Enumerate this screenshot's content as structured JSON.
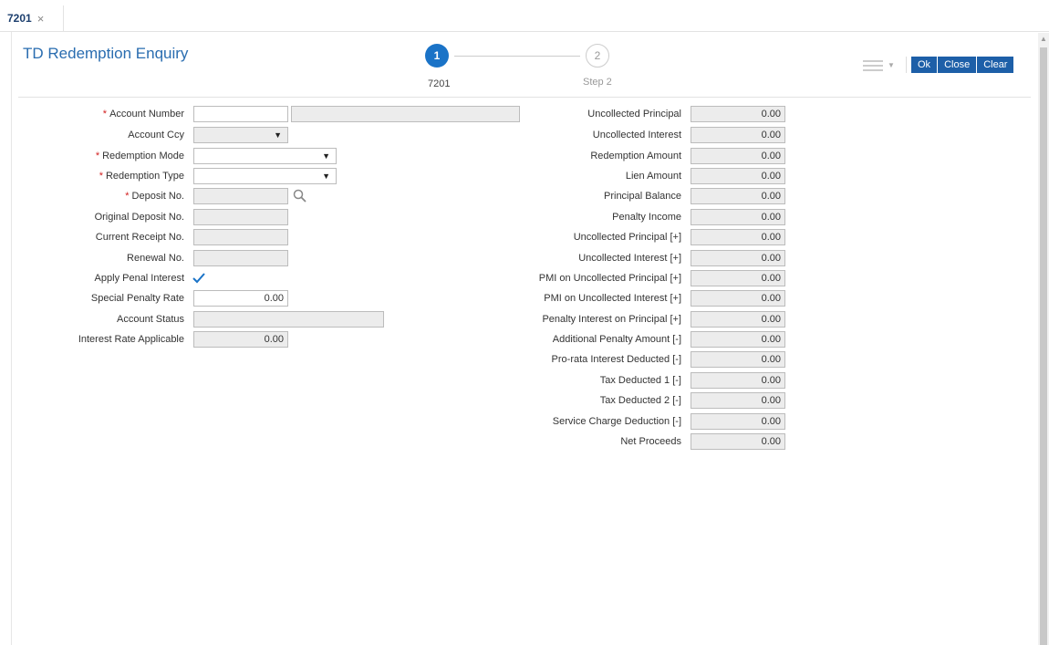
{
  "tab": {
    "label": "7201",
    "close": "×"
  },
  "title": "TD Redemption Enquiry",
  "steps": [
    {
      "number": "1",
      "label": "7201"
    },
    {
      "number": "2",
      "label": "Step 2"
    }
  ],
  "buttons": {
    "ok": "Ok",
    "close": "Close",
    "clear": "Clear"
  },
  "left_fields": {
    "account_number": {
      "label": "Account Number",
      "value": "",
      "value2": ""
    },
    "account_ccy": {
      "label": "Account Ccy",
      "value": ""
    },
    "redemption_mode": {
      "label": "Redemption Mode",
      "value": ""
    },
    "redemption_type": {
      "label": "Redemption Type",
      "value": ""
    },
    "deposit_no": {
      "label": "Deposit No.",
      "value": ""
    },
    "original_deposit_no": {
      "label": "Original Deposit No.",
      "value": ""
    },
    "current_receipt_no": {
      "label": "Current Receipt No.",
      "value": ""
    },
    "renewal_no": {
      "label": "Renewal No.",
      "value": ""
    },
    "apply_penal_interest": {
      "label": "Apply Penal Interest",
      "checked": true
    },
    "special_penalty_rate": {
      "label": "Special Penalty Rate",
      "value": "0.00"
    },
    "account_status": {
      "label": "Account Status",
      "value": ""
    },
    "interest_rate_applicable": {
      "label": "Interest Rate Applicable",
      "value": "0.00"
    }
  },
  "right_fields": [
    {
      "label": "Uncollected Principal",
      "value": "0.00"
    },
    {
      "label": "Uncollected Interest",
      "value": "0.00"
    },
    {
      "label": "Redemption Amount",
      "value": "0.00"
    },
    {
      "label": "Lien Amount",
      "value": "0.00"
    },
    {
      "label": "Principal Balance",
      "value": "0.00"
    },
    {
      "label": "Penalty Income",
      "value": "0.00"
    },
    {
      "label": "Uncollected Principal [+]",
      "value": "0.00"
    },
    {
      "label": "Uncollected Interest [+]",
      "value": "0.00"
    },
    {
      "label": "PMI on Uncollected Principal [+]",
      "value": "0.00"
    },
    {
      "label": "PMI on Uncollected Interest [+]",
      "value": "0.00"
    },
    {
      "label": "Penalty Interest on Principal [+]",
      "value": "0.00"
    },
    {
      "label": "Additional Penalty Amount [-]",
      "value": "0.00"
    },
    {
      "label": "Pro-rata Interest Deducted [-]",
      "value": "0.00"
    },
    {
      "label": "Tax Deducted 1 [-]",
      "value": "0.00"
    },
    {
      "label": "Tax Deducted 2 [-]",
      "value": "0.00"
    },
    {
      "label": "Service Charge Deduction [-]",
      "value": "0.00"
    },
    {
      "label": "Net Proceeds",
      "value": "0.00"
    }
  ],
  "icons": {
    "search": "search-icon",
    "check": "checkmark-icon",
    "menu": "hamburger-menu-icon"
  },
  "colors": {
    "accent": "#1d5fa8",
    "title": "#2a6db0",
    "required": "#d21f1f"
  }
}
